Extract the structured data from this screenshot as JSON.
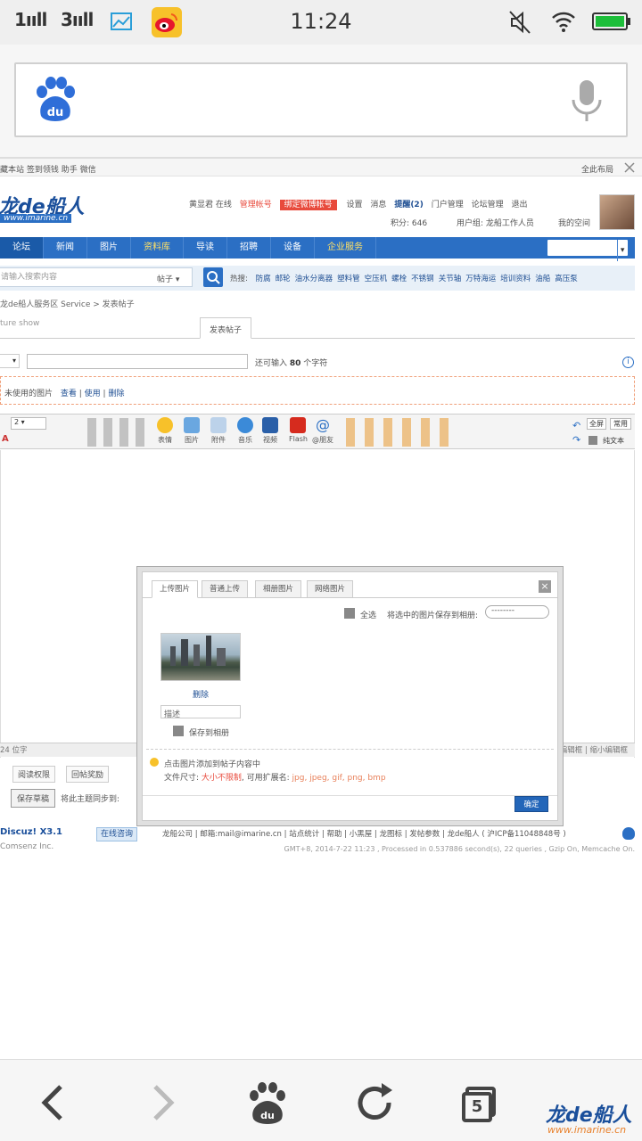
{
  "status_bar": {
    "signal1": "1ııll",
    "signal2": "3ııll",
    "time": "11:24"
  },
  "address_bar": {
    "brand_icon": "baidu-paw-icon",
    "mic_icon": "microphone-icon"
  },
  "webpage": {
    "top_links": "藏本站  签到领钱  助手  微信",
    "top_right": "全此布局",
    "logo_text": "龙de船人",
    "logo_url": "www.imarine.cn",
    "user_bar": {
      "items": [
        "黄显君 在线",
        "管理帐号",
        "绑定微博帐号",
        "设置",
        "消息",
        "提醒(2)",
        "门户管理",
        "论坛管理",
        "退出"
      ],
      "points": "积分: 646",
      "group": "用户组: 龙船工作人员",
      "space": "我的空间"
    },
    "nav": [
      "论坛",
      "新闻",
      "图片",
      "资料库",
      "导读",
      "招聘",
      "设备",
      "企业服务"
    ],
    "nav_yellow": [
      "资料库",
      "企业服务"
    ],
    "quick_nav": "快捷导航",
    "search": {
      "placeholder": "请输入搜索内容",
      "scope": "帖子",
      "hot_label": "热搜:",
      "hot": [
        "防腐",
        "邮轮",
        "油水分离器",
        "塑料管",
        "空压机",
        "螺栓",
        "不锈钢",
        "关节轴",
        "万特海运",
        "培训资料",
        "油船",
        "高压泵"
      ]
    },
    "breadcrumb": "龙de船人服务区 Service  >  发表帖子",
    "section_tab": "ture show",
    "post_tab": "发表帖子",
    "title_hint_pre": "还可输入 ",
    "title_hint_num": "80",
    "title_hint_post": " 个字符",
    "attach_line": [
      "未使用的图片",
      "查看",
      "使用",
      "删除"
    ],
    "editor_fontsize": "2",
    "editor_tools": [
      "表情",
      "图片",
      "附件",
      "音乐",
      "视频",
      "Flash",
      "@朋友"
    ],
    "editor_right": [
      "全屏",
      "常用",
      "纯文本"
    ],
    "footer_left": "24 位字",
    "footer_right": "恢复数据 | 加大编辑框 | 缩小编辑框",
    "perm_buttons": [
      "阅读权限",
      "回帖奖励"
    ],
    "submit_button": "保存草稿",
    "submit_hint": "将此主题同步到:",
    "powered": "Discuz! X3.1",
    "company": "Comsenz Inc.",
    "online_consult": "在线咨询",
    "footer_links": "龙船公司 | 邮箱:mail@imarine.cn | 站点统计 | 帮助 | 小黑屋 | 龙图标 | 发帖参数 | 龙de船人 ( 沪ICP备11048848号 )",
    "footer_stats": "GMT+8, 2014-7-22 11:23 , Processed in 0.537886 second(s), 22 queries , Gzip On, Memcache On."
  },
  "dialog": {
    "tabs": [
      "上传图片",
      "普通上传",
      "相册图片",
      "网络图片"
    ],
    "select_all": "全选",
    "save_to_album_label": "将选中的图片保存到相册:",
    "album_select": "--------",
    "delete_link": "删除",
    "desc_placeholder": "描述",
    "save_album_check": "保存到相册",
    "tip": "点击图片添加到帖子内容中",
    "filesize_label": "文件尺寸: ",
    "filesize_value": "大小不限制",
    "ext_label": ", 可用扩展名: ",
    "ext_value": "jpg, jpeg, gif, png, bmp",
    "ok_button": "确定"
  },
  "bottom_nav": {
    "tabs_count": "5",
    "brand": "龙de船人",
    "brand_url": "www.imarine.cn"
  },
  "colors": {
    "nav_blue": "#2b6fc4",
    "link_blue": "#1f4f93",
    "accent_red": "#e84a3c",
    "status_green": "#1dbe3a"
  }
}
